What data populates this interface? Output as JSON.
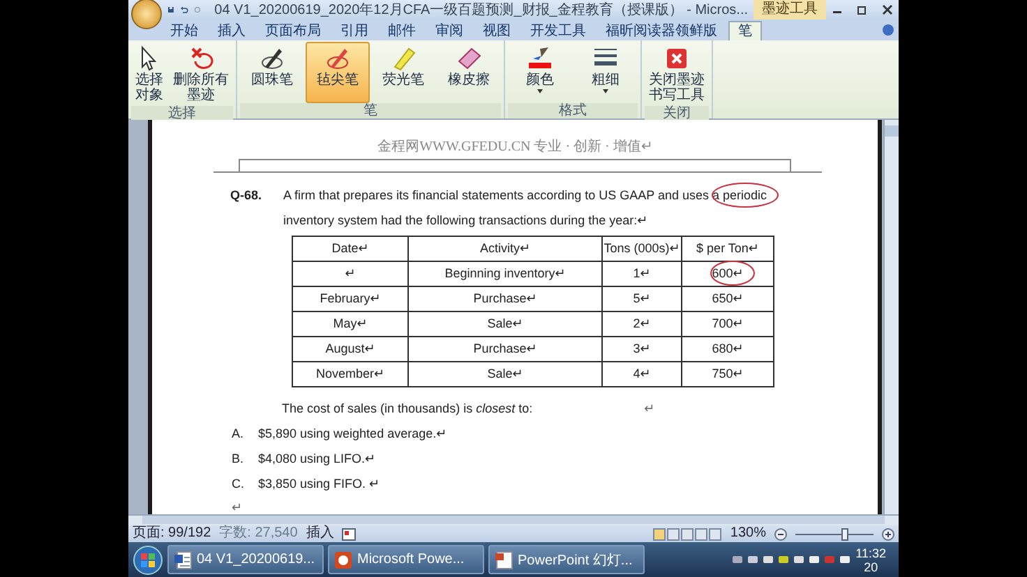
{
  "window": {
    "title": "04 V1_20200619_2020年12月CFA一级百题预测_财报_金程教育（授课版） - Micros...",
    "contextual_tab": "墨迹工具"
  },
  "ribbon_tabs": [
    {
      "label": "开始",
      "selected": false
    },
    {
      "label": "插入",
      "selected": false
    },
    {
      "label": "页面布局",
      "selected": false
    },
    {
      "label": "引用",
      "selected": false
    },
    {
      "label": "邮件",
      "selected": false
    },
    {
      "label": "审阅",
      "selected": false
    },
    {
      "label": "视图",
      "selected": false
    },
    {
      "label": "开发工具",
      "selected": false
    },
    {
      "label": "福昕阅读器领鲜版",
      "selected": false
    },
    {
      "label": "笔",
      "selected": true
    }
  ],
  "ribbon_groups": [
    {
      "label": "选择",
      "tools": [
        {
          "kind": "cursor",
          "label": "选择对象",
          "selected": false,
          "dropdown": false
        },
        {
          "kind": "delete",
          "label": "删除所有墨迹",
          "selected": false,
          "dropdown": false
        }
      ]
    },
    {
      "label": "笔",
      "tools": [
        {
          "kind": "pen",
          "label": "圆珠笔",
          "selected": false,
          "dropdown": false
        },
        {
          "kind": "felt",
          "label": "毡尖笔",
          "selected": true,
          "dropdown": false
        },
        {
          "kind": "highlighter",
          "label": "荧光笔",
          "selected": false,
          "dropdown": false
        },
        {
          "kind": "eraser",
          "label": "橡皮擦",
          "selected": false,
          "dropdown": false
        }
      ]
    },
    {
      "label": "格式",
      "tools": [
        {
          "kind": "color",
          "label": "颜色",
          "selected": false,
          "dropdown": true
        },
        {
          "kind": "weight",
          "label": "粗细",
          "selected": false,
          "dropdown": true
        }
      ]
    },
    {
      "label": "关闭",
      "tools": [
        {
          "kind": "close",
          "label": "关闭墨迹书写工具",
          "selected": false,
          "dropdown": false
        }
      ]
    }
  ],
  "document": {
    "header": "金程网WWW.GFEDU.CN 专业 · 创新 · 增值↵",
    "question_number": "Q-68.",
    "stem": [
      {
        "text": "A firm that prepares its financial statements according to US GAAP and uses ",
        "circled": false
      },
      {
        "text": "a periodic",
        "circled": true
      }
    ],
    "stem_line_2": "inventory system had the following transactions during the year:↵",
    "table": {
      "columns": [
        "Date↵",
        "Activity↵",
        "Tons (000s)↵",
        "$ per Ton↵"
      ],
      "rows": [
        {
          "cells": [
            {
              "text": "↵",
              "circled": false
            },
            {
              "text": "Beginning inventory↵",
              "circled": false
            },
            {
              "text": "1↵",
              "circled": false
            },
            {
              "text": "600↵",
              "circled": true
            }
          ]
        },
        {
          "cells": [
            {
              "text": "February↵",
              "circled": false
            },
            {
              "text": "Purchase↵",
              "circled": false
            },
            {
              "text": "5↵",
              "circled": false
            },
            {
              "text": "650↵",
              "circled": false
            }
          ]
        },
        {
          "cells": [
            {
              "text": "May↵",
              "circled": false
            },
            {
              "text": "Sale↵",
              "circled": false
            },
            {
              "text": "2↵",
              "circled": false
            },
            {
              "text": "700↵",
              "circled": false
            }
          ]
        },
        {
          "cells": [
            {
              "text": "August↵",
              "circled": false
            },
            {
              "text": "Purchase↵",
              "circled": false
            },
            {
              "text": "3↵",
              "circled": false
            },
            {
              "text": "680↵",
              "circled": false
            }
          ]
        },
        {
          "cells": [
            {
              "text": "November↵",
              "circled": false
            },
            {
              "text": "Sale↵",
              "circled": false
            },
            {
              "text": "4↵",
              "circled": false
            },
            {
              "text": "750↵",
              "circled": false
            }
          ]
        }
      ]
    },
    "prompt": "The cost of sales (in thousands) is *closest* to:",
    "prompt_mark": "↵",
    "options": [
      {
        "letter": "A.",
        "text": "$5,890 using weighted average.↵"
      },
      {
        "letter": "B.",
        "text": "$4,080 using LIFO.↵"
      },
      {
        "letter": "C.",
        "text": "$3,850 using FIFO.  ↵"
      }
    ],
    "end_mark": "↵"
  },
  "status_bar": {
    "page": "页面: 99/192",
    "words": "字数: 27,540",
    "mode": "插入",
    "zoom": "130%",
    "zoom_slider": {
      "level": 0.62
    }
  },
  "taskbar": {
    "buttons": [
      {
        "kind": "word",
        "label": "04 V1_20200619..."
      },
      {
        "kind": "powerpoint",
        "label": "Microsoft Powe..."
      },
      {
        "kind": "slideshow",
        "label": "PowerPoint 幻灯..."
      }
    ],
    "clock": "11:32",
    "clock_line_2": "20"
  }
}
